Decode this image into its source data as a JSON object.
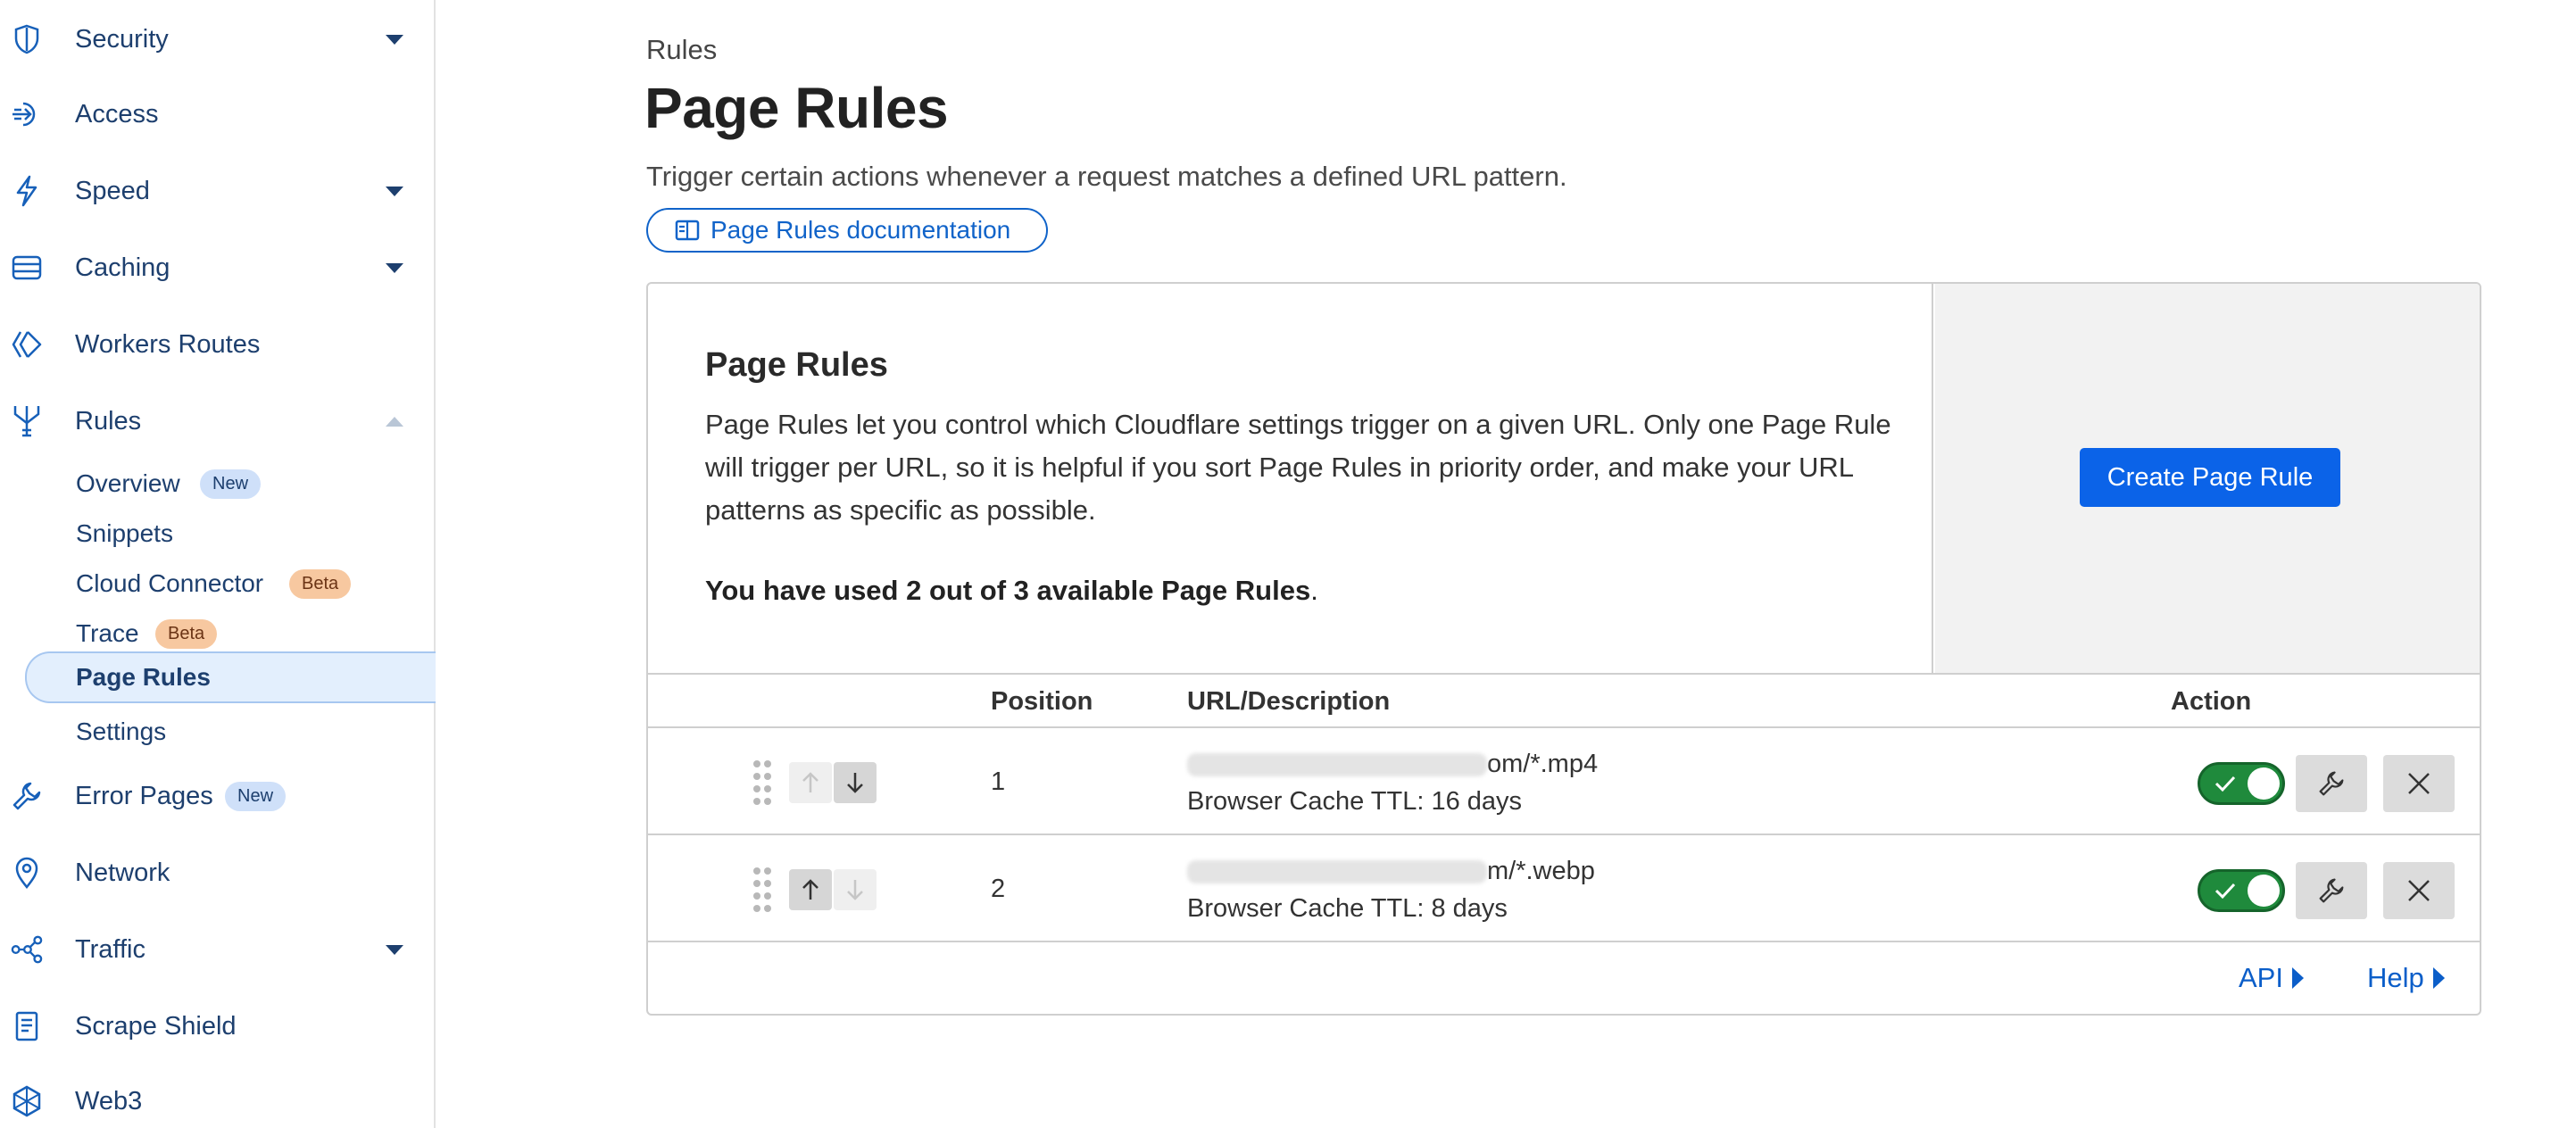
{
  "sidebar": {
    "items": [
      {
        "label": "Security",
        "icon": "shield-icon",
        "caret": "down"
      },
      {
        "label": "Access",
        "icon": "access-icon"
      },
      {
        "label": "Speed",
        "icon": "lightning-icon",
        "caret": "down"
      },
      {
        "label": "Caching",
        "icon": "cache-stack-icon",
        "caret": "down"
      },
      {
        "label": "Workers Routes",
        "icon": "workers-icon"
      },
      {
        "label": "Rules",
        "icon": "rules-fork-icon",
        "caret": "up"
      },
      {
        "label": "Error Pages",
        "icon": "wrench-icon",
        "badge": "New"
      },
      {
        "label": "Network",
        "icon": "location-pin-icon"
      },
      {
        "label": "Traffic",
        "icon": "traffic-nodes-icon",
        "caret": "down"
      },
      {
        "label": "Scrape Shield",
        "icon": "document-icon"
      },
      {
        "label": "Web3",
        "icon": "web3-icon"
      }
    ],
    "rules_sub": [
      {
        "label": "Overview",
        "badge": "New"
      },
      {
        "label": "Snippets"
      },
      {
        "label": "Cloud Connector",
        "badge": "Beta"
      },
      {
        "label": "Trace",
        "badge": "Beta"
      },
      {
        "label": "Page Rules",
        "active": true
      },
      {
        "label": "Settings"
      }
    ]
  },
  "header": {
    "breadcrumb": "Rules",
    "title": "Page Rules",
    "subtitle": "Trigger certain actions whenever a request matches a defined URL pattern.",
    "doc_button": "Page Rules documentation"
  },
  "card": {
    "title": "Page Rules",
    "description": "Page Rules let you control which Cloudflare settings trigger on a given URL. Only one Page Rule will trigger per URL, so it is helpful if you sort Page Rules in priority order, and make your URL patterns as specific as possible.",
    "usage_bold": "You have used 2 out of 3 available Page Rules",
    "usage_tail": ".",
    "create_button": "Create Page Rule"
  },
  "table": {
    "columns": [
      "Position",
      "URL/Description",
      "Action"
    ],
    "rows": [
      {
        "position": "1",
        "url_suffix": "om/*.mp4",
        "description": "Browser Cache TTL: 16 days",
        "enabled": true,
        "up_enabled": false,
        "down_enabled": true
      },
      {
        "position": "2",
        "url_suffix": "m/*.webp",
        "description": "Browser Cache TTL: 8 days",
        "enabled": true,
        "up_enabled": true,
        "down_enabled": false
      }
    ]
  },
  "footer": {
    "api": "API",
    "help": "Help"
  },
  "colors": {
    "accent": "#0b63e8",
    "link": "#0b5ec9",
    "toggle_on": "#1f8a3c",
    "nav_icon": "#1760b9"
  }
}
